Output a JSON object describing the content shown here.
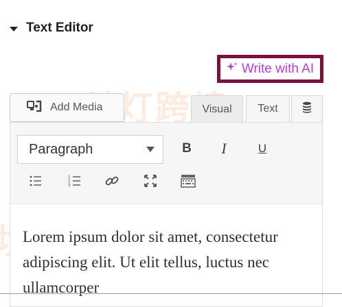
{
  "section": {
    "title": "Text Editor"
  },
  "ai_button": {
    "label": "Write with AI",
    "color": "#b23dd3",
    "border_color": "#7c0f3d"
  },
  "media": {
    "label": "Add Media"
  },
  "tabs": {
    "visual": "Visual",
    "text": "Text"
  },
  "toolbar": {
    "format_value": "Paragraph",
    "bold": "B",
    "italic": "I",
    "underline": "U"
  },
  "content": {
    "text": "Lorem ipsum dolor sit amet, consectetur adipiscing elit. Ut elit tellus, luctus nec ullamcorper"
  },
  "watermark": {
    "text1": "科灯跨境",
    "text2": "境"
  },
  "icons": [
    "caret-down-icon",
    "sparkle-icon",
    "add-media-icon",
    "stack-icon",
    "bullet-list-icon",
    "numbered-list-icon",
    "link-icon",
    "fullscreen-icon",
    "toolbar-toggle-icon"
  ]
}
